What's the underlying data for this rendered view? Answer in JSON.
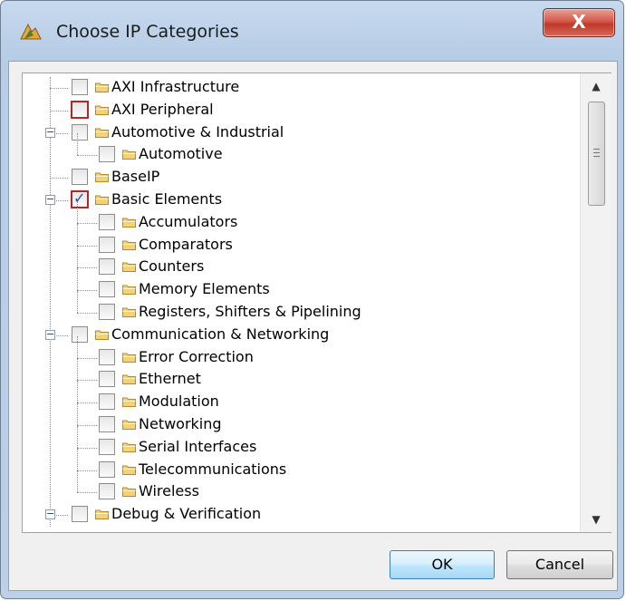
{
  "window": {
    "title": "Choose IP Categories",
    "close_label": "X"
  },
  "tree": {
    "items": [
      {
        "label": "AXI Infrastructure",
        "level": 0,
        "checked": false,
        "highlight": false,
        "expander": "none"
      },
      {
        "label": "AXI Peripheral",
        "level": 0,
        "checked": false,
        "highlight": true,
        "expander": "none"
      },
      {
        "label": "Automotive & Industrial",
        "level": 0,
        "checked": false,
        "highlight": false,
        "expander": "minus"
      },
      {
        "label": "Automotive",
        "level": 1,
        "checked": false,
        "highlight": false,
        "expander": "none"
      },
      {
        "label": "BaseIP",
        "level": 0,
        "checked": false,
        "highlight": false,
        "expander": "none"
      },
      {
        "label": "Basic Elements",
        "level": 0,
        "checked": true,
        "highlight": true,
        "expander": "minus"
      },
      {
        "label": "Accumulators",
        "level": 1,
        "checked": false,
        "highlight": false,
        "expander": "none"
      },
      {
        "label": "Comparators",
        "level": 1,
        "checked": false,
        "highlight": false,
        "expander": "none"
      },
      {
        "label": "Counters",
        "level": 1,
        "checked": false,
        "highlight": false,
        "expander": "none"
      },
      {
        "label": "Memory Elements",
        "level": 1,
        "checked": false,
        "highlight": false,
        "expander": "none"
      },
      {
        "label": "Registers, Shifters & Pipelining",
        "level": 1,
        "checked": false,
        "highlight": false,
        "expander": "none"
      },
      {
        "label": "Communication & Networking",
        "level": 0,
        "checked": false,
        "highlight": false,
        "expander": "minus"
      },
      {
        "label": "Error Correction",
        "level": 1,
        "checked": false,
        "highlight": false,
        "expander": "none"
      },
      {
        "label": "Ethernet",
        "level": 1,
        "checked": false,
        "highlight": false,
        "expander": "none"
      },
      {
        "label": "Modulation",
        "level": 1,
        "checked": false,
        "highlight": false,
        "expander": "none"
      },
      {
        "label": "Networking",
        "level": 1,
        "checked": false,
        "highlight": false,
        "expander": "none"
      },
      {
        "label": "Serial Interfaces",
        "level": 1,
        "checked": false,
        "highlight": false,
        "expander": "none"
      },
      {
        "label": "Telecommunications",
        "level": 1,
        "checked": false,
        "highlight": false,
        "expander": "none"
      },
      {
        "label": "Wireless",
        "level": 1,
        "checked": false,
        "highlight": false,
        "expander": "none"
      },
      {
        "label": "Debug & Verification",
        "level": 0,
        "checked": false,
        "highlight": false,
        "expander": "minus"
      }
    ]
  },
  "buttons": {
    "ok_label": "OK",
    "cancel_label": "Cancel"
  },
  "colors": {
    "highlight_border": "#b3262a",
    "check_mark": "#2b4fa8",
    "folder_fill": "#f3d27a",
    "close_button": "#c7463a"
  }
}
